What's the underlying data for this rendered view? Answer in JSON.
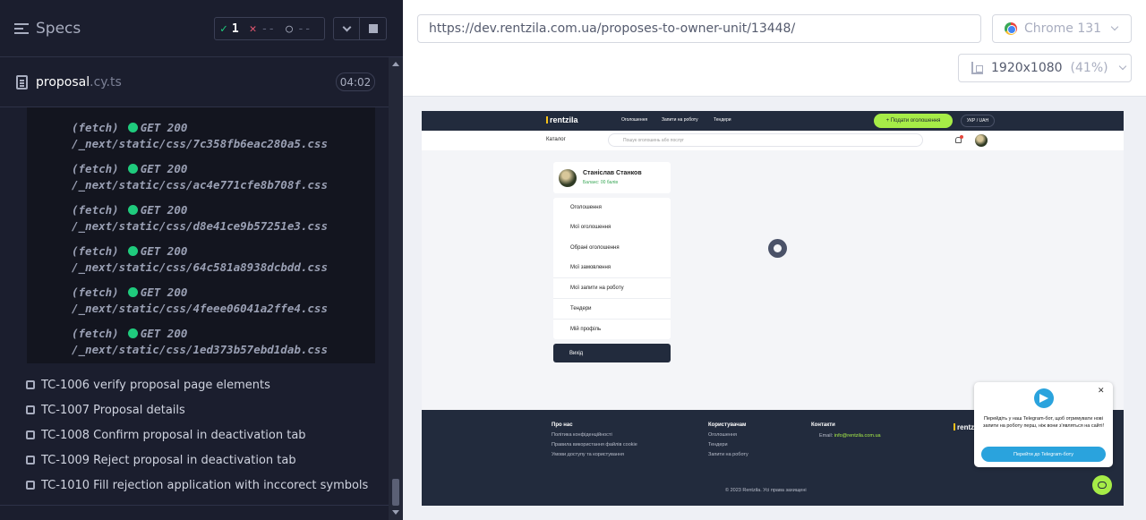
{
  "reporter": {
    "specs_label": "Specs",
    "stats": {
      "passed": "1",
      "failed": "--",
      "pending": "--"
    },
    "file": {
      "name": "proposal",
      "ext": ".cy.ts",
      "duration": "04:02"
    },
    "log_entries": [
      {
        "type": "(fetch)",
        "method": "GET 200",
        "path": "/_next/static/css/7c358fb6eac280a5.css"
      },
      {
        "type": "(fetch)",
        "method": "GET 200",
        "path": "/_next/static/css/ac4e771cfe8b708f.css"
      },
      {
        "type": "(fetch)",
        "method": "GET 200",
        "path": "/_next/static/css/d8e41ce9b57251e3.css"
      },
      {
        "type": "(fetch)",
        "method": "GET 200",
        "path": "/_next/static/css/64c581a8938dcbdd.css"
      },
      {
        "type": "(fetch)",
        "method": "GET 200",
        "path": "/_next/static/css/4feee06041a2ffe4.css"
      },
      {
        "type": "(fetch)",
        "method": "GET 200",
        "path": "/_next/static/css/1ed373b57ebd1dab.css"
      }
    ],
    "tests": [
      "TC-1006 verify proposal page elements",
      "TC-1007 Proposal details",
      "TC-1008 Confirm proposal in deactivation tab",
      "TC-1009 Reject proposal in deactivation tab",
      "TC-1010 Fill rejection application with inccorect symbols"
    ]
  },
  "aut": {
    "url": "https://dev.rentzila.com.ua/proposes-to-owner-unit/13448/",
    "browser": "Chrome 131",
    "viewport": "1920x1080",
    "zoom": "(41%)"
  },
  "site": {
    "logo": "rentzila",
    "nav": [
      "Оголошення",
      "Запити на роботу",
      "Тендери"
    ],
    "add_button": "+ Подати оголошення",
    "lang": "УКР / UAH",
    "catalog": "Каталог",
    "search_placeholder": "Пошук оголошень або послуг",
    "profile_name": "Станіслав Станков",
    "balance_label": "Баланс:",
    "balance_value": "00 балів",
    "menu": {
      "ads": "Оголошення",
      "my_ads": "Мої оголошення",
      "favorites": "Обрані оголошення",
      "orders": "Мої замовлення",
      "requests": "Мої запити на роботу",
      "tenders": "Тендери",
      "profile": "Мій профіль",
      "exit": "Вихід"
    },
    "footer": {
      "about": "Про нас",
      "privacy": "Політика конфіденційності",
      "cookies": "Правила використання файлів cookie",
      "terms": "Умови доступу та користування",
      "users": "Користувачам",
      "u_ads": "Оголошення",
      "u_tenders": "Тендери",
      "u_requests": "Запити на роботу",
      "contacts": "Контакти",
      "email_label": "Email:",
      "email": "info@rentzila.com.ua",
      "copyright": "© 2023 Rentzila. Усі права захищені",
      "logo": "rentzila"
    },
    "telegram": {
      "text": "Перейдіть у наш Telegram-бот, щоб отримувати нові запити на роботу перш, ніж вони з'являться на сайті!",
      "button": "Перейти до Telegram-боту"
    }
  }
}
